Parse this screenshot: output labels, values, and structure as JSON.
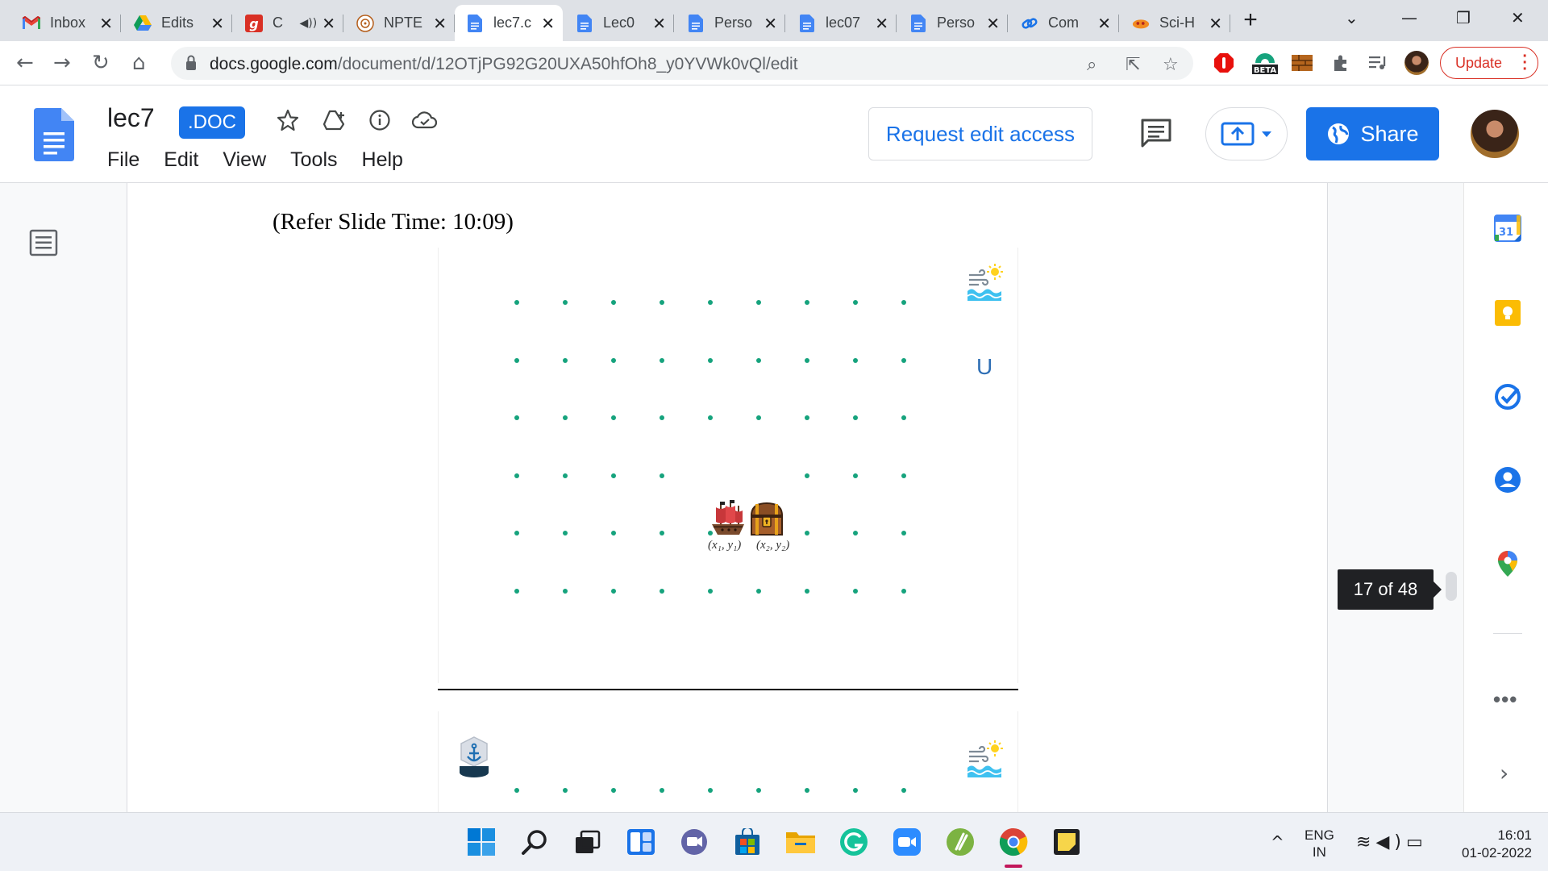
{
  "browser": {
    "tabs": [
      {
        "title": "Inbox",
        "icon": "gmail-icon",
        "active": false
      },
      {
        "title": "Edits",
        "icon": "google-drive-icon",
        "active": false
      },
      {
        "title": "C",
        "icon": "grammarly-g-icon",
        "active": false,
        "audio": true
      },
      {
        "title": "NPTE",
        "icon": "nptel-icon",
        "active": false
      },
      {
        "title": "lec7.c",
        "icon": "google-docs-icon",
        "active": true
      },
      {
        "title": "Lec0",
        "icon": "google-docs-icon",
        "active": false
      },
      {
        "title": "Perso",
        "icon": "google-docs-icon",
        "active": false
      },
      {
        "title": "lec07",
        "icon": "google-docs-icon",
        "active": false
      },
      {
        "title": "Perso",
        "icon": "google-docs-icon",
        "active": false
      },
      {
        "title": "Com",
        "icon": "link-icon",
        "active": false
      },
      {
        "title": "Sci-H",
        "icon": "sci-hub-icon",
        "active": false
      }
    ],
    "url_host": "docs.google.com",
    "url_path": "/document/d/12OTjPG92G20UXA50hfOh8_y0YVWk0vQl/edit",
    "ext_badge": "BETA",
    "update_label": "Update",
    "colors": {
      "accent": "#1a73e8",
      "update": "#d93025"
    }
  },
  "docs": {
    "title": "lec7",
    "badge": ".DOC",
    "menu": [
      "File",
      "Edit",
      "View",
      "Tools",
      "Help"
    ],
    "request_edit_label": "Request edit access",
    "share_label": "Share"
  },
  "document": {
    "refer_text": "(Refer Slide Time: 10:09)",
    "slide": {
      "grid_rows": 6,
      "grid_cols": 9,
      "dot_color": "#16a37d",
      "ship_coord": "(x₁, y₁)",
      "chest_coord": "(x₂, y₂)",
      "u_label": "U",
      "icons": [
        "wind-sun-water-icon",
        "pirate-ship-icon",
        "treasure-chest-icon"
      ]
    },
    "slide2": {
      "icons": [
        "anchor-compass-icon",
        "wind-sun-water-icon"
      ]
    },
    "page_counter": "17 of 48"
  },
  "side_panel": {
    "calendar_day": "31",
    "items": [
      "google-calendar-icon",
      "google-keep-icon",
      "google-tasks-icon",
      "contacts-icon",
      "google-maps-icon"
    ]
  },
  "taskbar": {
    "apps": [
      "windows-start-icon",
      "search-icon",
      "task-view-icon",
      "widgets-icon",
      "teams-chat-icon",
      "microsoft-store-icon",
      "file-explorer-icon",
      "grammarly-icon",
      "zoom-icon",
      "green-app-icon",
      "chrome-icon",
      "sticky-notes-icon"
    ],
    "lang_top": "ENG",
    "lang_bottom": "IN",
    "time": "16:01",
    "date": "01-02-2022"
  }
}
